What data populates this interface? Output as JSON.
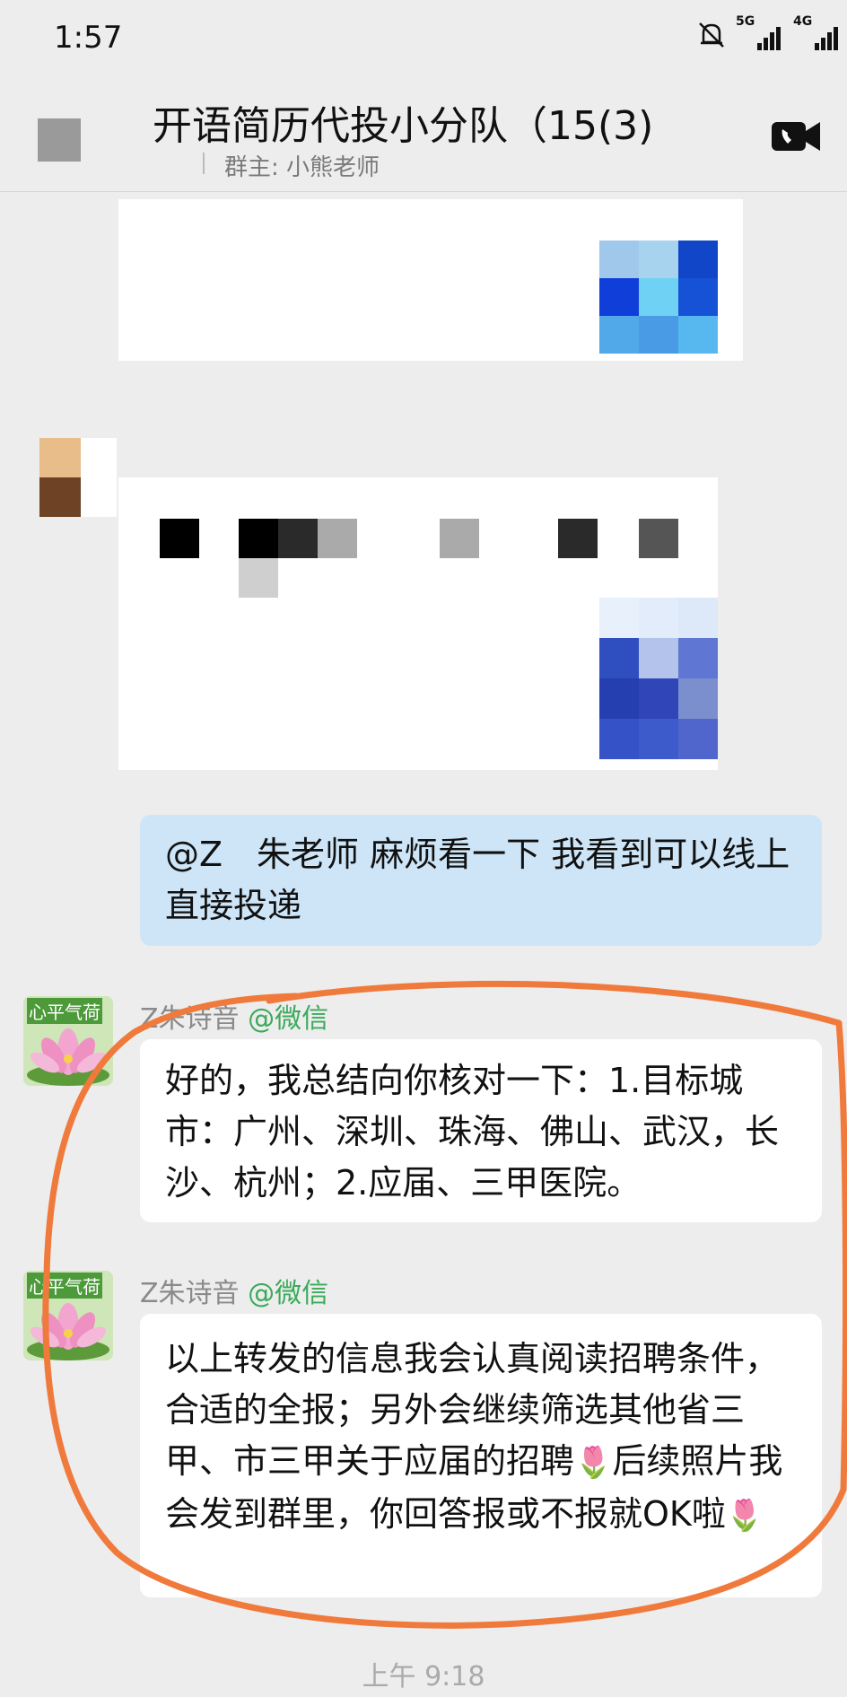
{
  "status_bar": {
    "time": "1:57",
    "net1": "5G",
    "net2": "4G",
    "icons": [
      "bell-muted-icon",
      "signal-icon",
      "signal-icon"
    ]
  },
  "header": {
    "title": "​语简历代投小分队（15(3)",
    "title_display": "开语简历代投小分队（15(3)",
    "subtitle": "群主: 小熊老师",
    "back_icon": "back-icon",
    "video_icon": "video-call-icon"
  },
  "messages": [
    {
      "type": "self",
      "text": "@Z　朱老师 麻烦看一下  我看到可以线上直接投递"
    },
    {
      "type": "other",
      "sender": "Z朱诗音",
      "source": "@微信",
      "avatar_badge": "心平气荷",
      "text": "好的，我总结向你核对一下：1.目标城市：广州、深圳、珠海、佛山、武汉，长沙、杭州；2.应届、三甲医院。"
    },
    {
      "type": "other",
      "sender": "Z朱诗音",
      "source": "@微信",
      "avatar_badge": "心平气荷",
      "text_part1": "以上转发的信息我会认真阅读招聘条件，合适的全报；另外会继续筛选其他省三甲、市三甲关于应届的招聘",
      "text_part2": "后续照片我会发到群里，你回答报或不报就OK啦",
      "emoji": "🌷"
    }
  ],
  "timestamp": "上午 9:18",
  "colors": {
    "background": "#ededed",
    "self_bubble": "#cde5f7",
    "other_bubble": "#ffffff",
    "highlight_circle": "#f07a3c",
    "source_green": "#3caa5b"
  }
}
